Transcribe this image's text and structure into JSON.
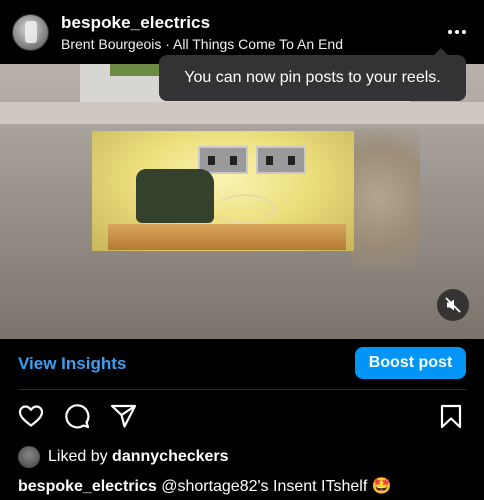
{
  "header": {
    "username": "bespoke_electrics",
    "subtitle": "Brent Bourgeois · All Things Come To An End",
    "more_icon": "more-horizontal-icon"
  },
  "tooltip": {
    "text": "You can now pin posts to your reels."
  },
  "media": {
    "type": "video",
    "mute_icon": "speaker-muted-icon"
  },
  "actions": {
    "view_insights": "View Insights",
    "boost_post": "Boost post",
    "icons": [
      "heart-icon",
      "comment-icon",
      "share-icon",
      "bookmark-icon"
    ]
  },
  "likes": {
    "prefix": "Liked by ",
    "user": "dannycheckers"
  },
  "caption": {
    "author": "bespoke_electrics",
    "text": " @shortage82's Insent ITshelf 🤩"
  },
  "colors": {
    "accent_blue": "#0095f6",
    "link_blue": "#3c9ff1",
    "background": "#000000",
    "tooltip_bg": "#333335"
  }
}
